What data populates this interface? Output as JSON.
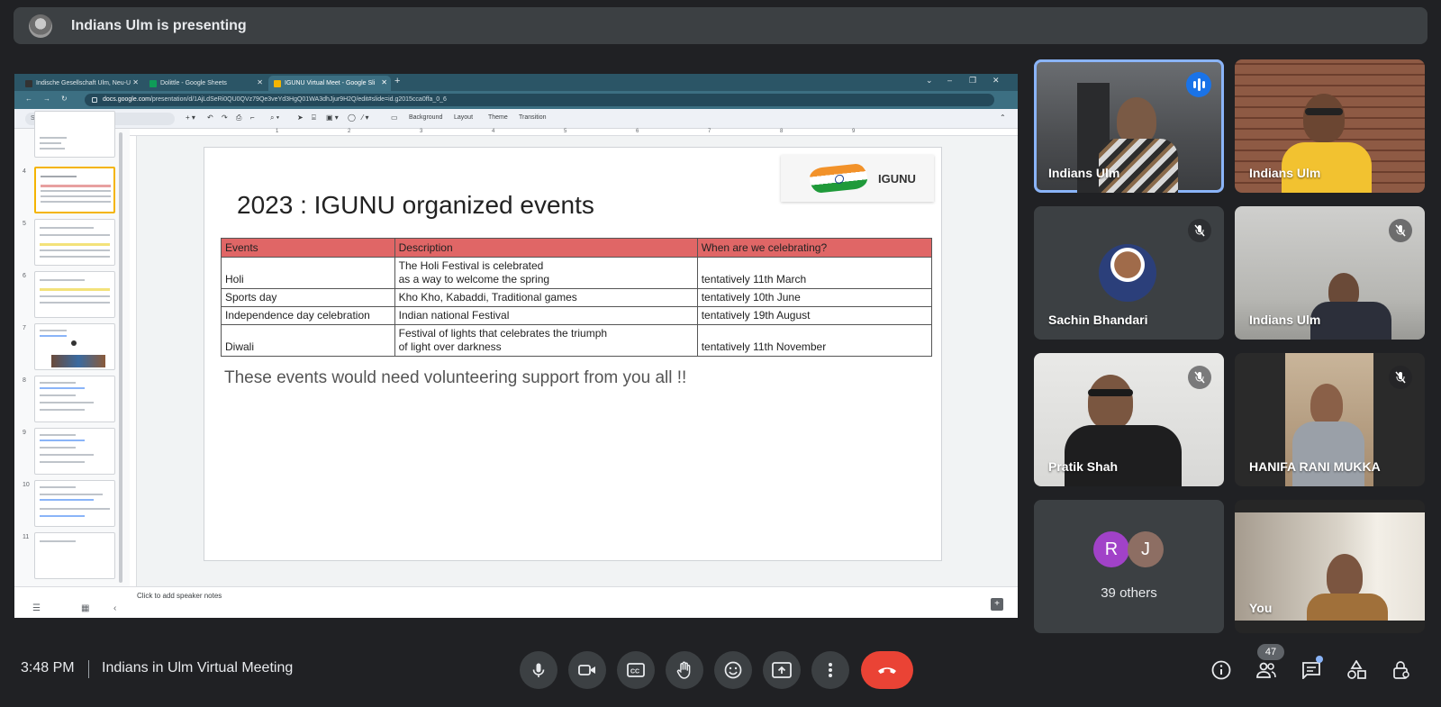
{
  "banner": {
    "text": "Indians Ulm is presenting"
  },
  "browser": {
    "tabs": [
      {
        "label": "Indische Gesellschaft Ulm, Neu-U"
      },
      {
        "label": "Dolittle - Google Sheets"
      },
      {
        "label": "IGUNU Virtual Meet - Google Sli"
      }
    ],
    "url_host": "docs.google.com",
    "url_path": "/presentation/d/1AjLdSeRi0QU0QVz79Qe3veYd3HgQ01WA3dhJjur9H2Q/edit#slide=id.g2015cca0ffa_0_6"
  },
  "slides_toolbar": {
    "menu_search_placeholder": "Search the menus (Alt+/)",
    "background": "Background",
    "layout": "Layout",
    "theme": "Theme",
    "transition": "Transition"
  },
  "thumbnails": [
    "4",
    "5",
    "6",
    "7",
    "8",
    "9",
    "10",
    "11"
  ],
  "ruler_marks": [
    "1",
    "2",
    "3",
    "4",
    "5",
    "6",
    "7",
    "8",
    "9"
  ],
  "slide": {
    "logo_text": "IGUNU",
    "title": "2023 : IGUNU organized events",
    "headers": [
      "Events",
      "Description",
      "When are we celebrating?"
    ],
    "rows": [
      {
        "event": "Holi",
        "desc1": "The Holi Festival is celebrated",
        "desc2": "as a way to welcome the spring",
        "when": "tentatively 11th March"
      },
      {
        "event": "Sports day",
        "desc1": "Kho Kho, Kabaddi, Traditional games",
        "desc2": "",
        "when": "tentatively 10th June"
      },
      {
        "event": "Independence day celebration",
        "desc1": "Indian national Festival",
        "desc2": "",
        "when": "tentatively 19th August"
      },
      {
        "event": "Diwali",
        "desc1": "Festival of lights that celebrates the triumph",
        "desc2": "of light over darkness",
        "when": "tentatively 11th November"
      }
    ],
    "footer": "These events would need volunteering support from you all !!"
  },
  "speaker_notes": "Click to add speaker notes",
  "participants": [
    {
      "name": "Indians Ulm",
      "state": "speaking"
    },
    {
      "name": "Indians Ulm",
      "state": "unmuted"
    },
    {
      "name": "Sachin Bhandari",
      "state": "muted"
    },
    {
      "name": "Indians Ulm",
      "state": "muted"
    },
    {
      "name": "Pratik Shah",
      "state": "muted"
    },
    {
      "name": "HANIFA RANI MUKKA",
      "state": "muted"
    },
    {
      "name": "You",
      "state": "unmuted"
    }
  ],
  "others": {
    "initials": [
      "R",
      "J"
    ],
    "label": "39 others",
    "colors": [
      "#a142c8",
      "#8d6e63"
    ]
  },
  "bottom": {
    "time": "3:48 PM",
    "meeting": "Indians in Ulm Virtual Meeting",
    "people_count": "47"
  },
  "colors": {
    "accent": "#8ab4f8",
    "end_call": "#ea4335",
    "table_header": "#e06666",
    "speaking": "#1a73e8"
  }
}
